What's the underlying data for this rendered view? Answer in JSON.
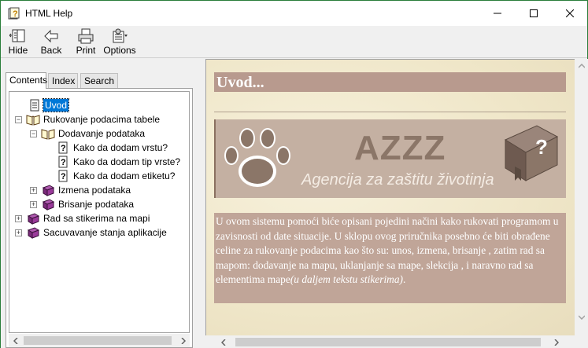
{
  "window": {
    "title": "HTML Help",
    "controls": {
      "minimize": "minimize",
      "maximize": "maximize",
      "close": "close"
    }
  },
  "toolbar": {
    "hide_label": "Hide",
    "back_label": "Back",
    "print_label": "Print",
    "options_label": "Options"
  },
  "tabs": [
    {
      "label": "Contents",
      "active": true
    },
    {
      "label": "Index",
      "active": false
    },
    {
      "label": "Search",
      "active": false
    }
  ],
  "tree": [
    {
      "label": "Uvod",
      "icon": "page-icon",
      "selected": true
    },
    {
      "label": "Rukovanje podacima tabele",
      "icon": "open-book-icon",
      "expanded": true
    },
    {
      "label": "Dodavanje podataka",
      "icon": "open-book-icon",
      "expanded": true
    },
    {
      "label": "Kako da dodam vrstu?",
      "icon": "help-page-icon"
    },
    {
      "label": "Kako da dodam tip vrste?",
      "icon": "help-page-icon"
    },
    {
      "label": "Kako da dodam etiketu?",
      "icon": "help-page-icon"
    },
    {
      "label": "Izmena podataka",
      "icon": "closed-book-icon",
      "expanded": false
    },
    {
      "label": "Brisanje podataka",
      "icon": "closed-book-icon",
      "expanded": false
    },
    {
      "label": "Rad sa stikerima na mapi",
      "icon": "closed-book-icon",
      "expanded": false
    },
    {
      "label": "Sacuvavanje stanja aplikacije",
      "icon": "closed-book-icon",
      "expanded": false
    }
  ],
  "content": {
    "heading": "Uvod...",
    "banner_title": "AZZZ",
    "banner_subtitle": "Agencija za zaštitu životinja",
    "body_main": "U ovom sistemu pomoći biće opisani pojedini načini kako rukovati programom u zavisnosti od date situacije. U sklopu ovog priručnika posebno će biti obrađene celine za rukovanje podacima kao što su: unos, izmena, brisanje , zatim rad sa mapom: dodavanje na mapu, uklanjanje sa mape, slekcija , i naravno rad sa elementima mape",
    "body_italic": "(u daljem tekstu stikerima)",
    "body_end": "."
  },
  "colors": {
    "heading_bar": "#b89a8e",
    "banner_bg": "#c4b0a2",
    "body_block": "#c0a598",
    "selection": "#0078d7",
    "window_border": "#2a7e3a"
  }
}
